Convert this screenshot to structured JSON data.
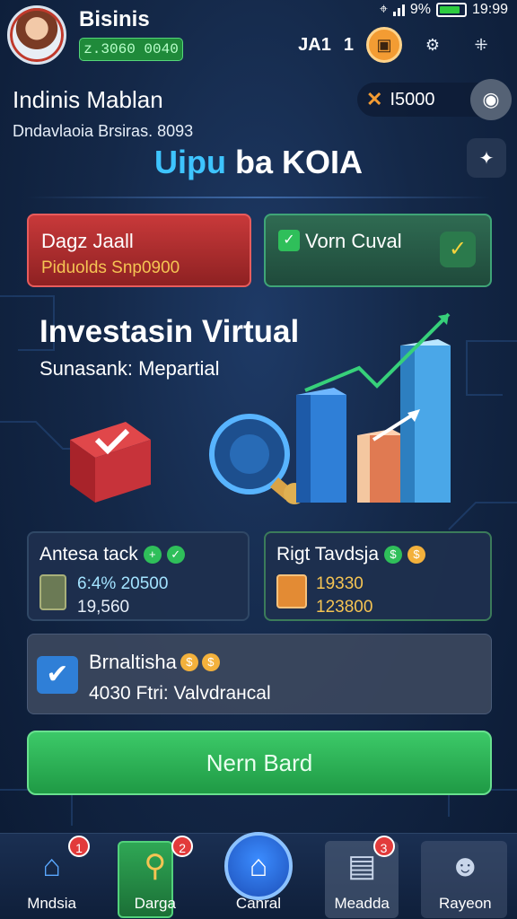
{
  "status_bar": {
    "signal_text": "3⃞ıl ıl",
    "battery": "9%",
    "time": "19:99"
  },
  "header": {
    "app_name": "Bisinis",
    "balance": "ᴢ.3060 0040",
    "counter_a": "JA1",
    "counter_b": "1",
    "icons": [
      "photo-icon",
      "settings-icon",
      "grid-icon"
    ]
  },
  "user": {
    "name": "Indinis Mablan",
    "subtitle": "Dndavlaoia Brsiras. 8093",
    "points": "I5000"
  },
  "headline": {
    "part1": "Uipu",
    "part2": "ba KOIA"
  },
  "cards": {
    "red": {
      "title": "Dagz Jaall",
      "subtitle": "Piduolds Snp0900"
    },
    "green": {
      "title": "Vorn Cuval"
    }
  },
  "hero": {
    "title": "Investasin Virtual",
    "subtitle": "Sunasank: Mepartial"
  },
  "stats": {
    "left": {
      "title": "Antesa tack",
      "value1": "6:4% 20500",
      "value2": "19,560"
    },
    "right": {
      "title": "Rigt Tavdsja",
      "value1": "19330",
      "value2": "123800"
    }
  },
  "promo": {
    "title": "Brnaltisha",
    "subtitle": "4030 Ftri: Valvdrансal"
  },
  "cta": {
    "label": "Nern Bard"
  },
  "nav": [
    {
      "label": "Mndsia",
      "badge": "1",
      "icon": "home-icon"
    },
    {
      "label": "Darga",
      "badge": "2",
      "icon": "trophy-icon"
    },
    {
      "label": "Canral",
      "badge": "",
      "icon": "home-icon"
    },
    {
      "label": "Meadda",
      "badge": "3",
      "icon": "document-icon"
    },
    {
      "label": "Rayeon",
      "badge": "",
      "icon": "profile-icon"
    }
  ],
  "colors": {
    "accent": "#3ec4ff",
    "green": "#2fbf5a",
    "red": "#c8393a",
    "orange": "#f39c33"
  }
}
